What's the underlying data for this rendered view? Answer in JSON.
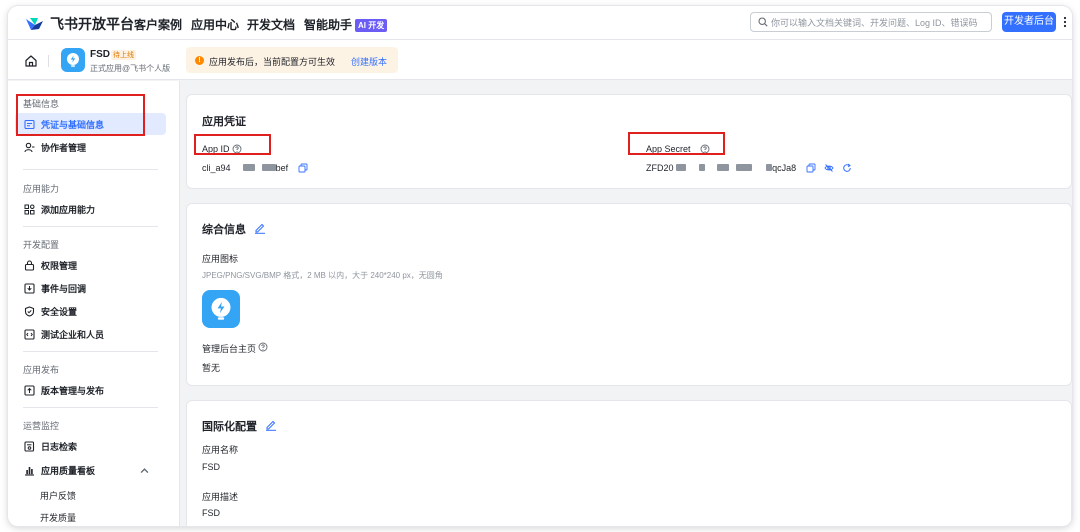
{
  "topnav": {
    "brand": "飞书开放平台",
    "items": [
      "客户案例",
      "应用中心",
      "开发文档",
      "智能助手"
    ],
    "ai_badge": "AI 开发",
    "search_placeholder": "你可以输入文档关键词、开发问题、Log ID、错误码",
    "dev_console": "开发者后台"
  },
  "appbar": {
    "app_name": "FSD",
    "app_status": "待上线",
    "app_sub": "正式应用@飞书个人版",
    "notice_text": "应用发布后，当前配置方可生效",
    "notice_link": "创建版本"
  },
  "sidebar": {
    "groups": {
      "basic": "基础信息",
      "ability": "应用能力",
      "dev": "开发配置",
      "release": "应用发布",
      "ops": "运营监控"
    },
    "items": {
      "credentials": "凭证与基础信息",
      "collaborators": "协作者管理",
      "add_ability": "添加应用能力",
      "permissions": "权限管理",
      "events": "事件与回调",
      "security": "安全设置",
      "test_org": "测试企业和人员",
      "versions": "版本管理与发布",
      "logs": "日志检索",
      "quality": "应用质量看板",
      "feedback": "用户反馈",
      "dev_quality": "开发质量"
    }
  },
  "credentials": {
    "title": "应用凭证",
    "app_id_label": "App ID",
    "app_id_prefix": "cli_a94",
    "app_id_suffix": "bef",
    "app_secret_label": "App Secret",
    "app_secret_prefix": "ZFD20",
    "app_secret_suffix": "qcJa8"
  },
  "general": {
    "title": "综合信息",
    "icon_label": "应用图标",
    "icon_hint": "JPEG/PNG/SVG/BMP 格式，2 MB 以内，大于 240*240 px，无圆角",
    "admin_home_label": "管理后台主页",
    "admin_home_value": "暂无"
  },
  "i18n": {
    "title": "国际化配置",
    "name_label": "应用名称",
    "name_value": "FSD",
    "desc_label": "应用描述",
    "desc_value": "FSD"
  },
  "colors": {
    "primary": "#3370ff",
    "highlight": "#e0201f",
    "app_icon": "#34a4f5"
  }
}
